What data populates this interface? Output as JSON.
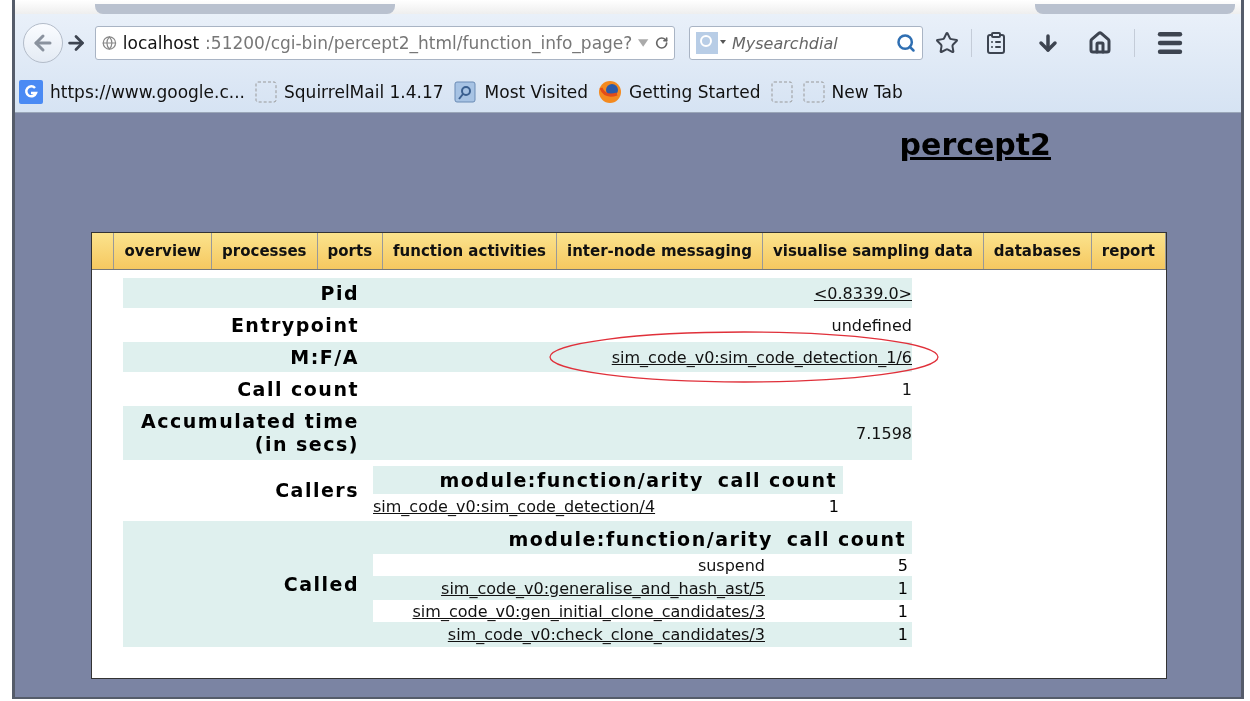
{
  "browser": {
    "url_host": "localhost",
    "url_path": ":51200/cgi-bin/percept2_html/function_info_page?",
    "search_placeholder": "Mysearchdial",
    "bookmarks": [
      {
        "label": "https://www.google.c..."
      },
      {
        "label": "SquirrelMail 1.4.17"
      },
      {
        "label": "Most Visited"
      },
      {
        "label": "Getting Started"
      },
      {
        "kind": "icon-only"
      },
      {
        "label": "New Tab"
      }
    ]
  },
  "page": {
    "title": "percept2",
    "nav": [
      "overview",
      "processes",
      "ports",
      "function activities",
      "inter-node messaging",
      "visualise sampling data",
      "databases",
      "report"
    ],
    "rows": [
      {
        "kind": "value",
        "label": "Pid",
        "value": "<0.8339.0>",
        "link": true,
        "highlighted": false
      },
      {
        "kind": "value",
        "label": "Entrypoint",
        "value": "undefined",
        "link": false,
        "highlighted": false
      },
      {
        "kind": "value",
        "label": "M:F/A",
        "value": "sim_code_v0:sim_code_detection_1/6",
        "link": true,
        "highlighted": true
      },
      {
        "kind": "value",
        "label": "Call count",
        "value": "1",
        "link": false,
        "highlighted": false
      },
      {
        "kind": "value",
        "label": "Accumulated time (in secs)",
        "value": "7.1598",
        "link": false,
        "highlighted": false
      },
      {
        "kind": "callers",
        "label": "Callers",
        "columns": [
          "module:function/arity",
          "call count"
        ],
        "entries": [
          {
            "name": "sim_code_v0:sim_code_detection/4",
            "link": true,
            "count": "1"
          }
        ]
      },
      {
        "kind": "called",
        "label": "Called",
        "columns": [
          "module:function/arity",
          "call count"
        ],
        "entries": [
          {
            "name": "suspend",
            "link": false,
            "count": "5"
          },
          {
            "name": "sim_code_v0:generalise_and_hash_ast/5",
            "link": true,
            "count": "1"
          },
          {
            "name": "sim_code_v0:gen_initial_clone_candidates/3",
            "link": true,
            "count": "1"
          },
          {
            "name": "sim_code_v0:check_clone_candidates/3",
            "link": true,
            "count": "1"
          }
        ]
      }
    ]
  }
}
